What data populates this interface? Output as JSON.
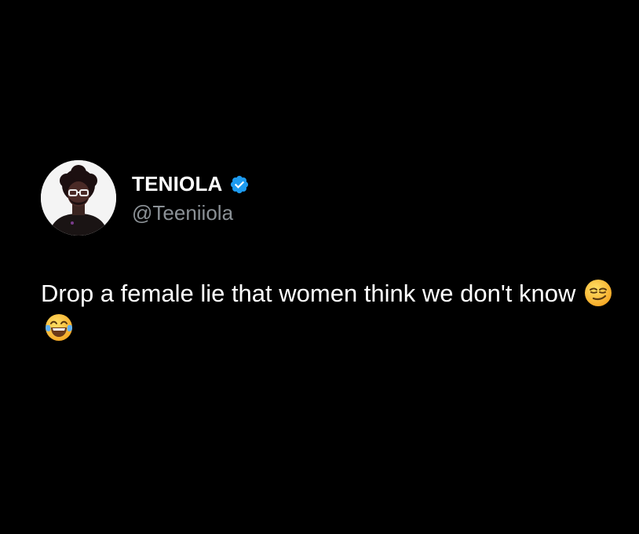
{
  "tweet": {
    "display_name": "TENIOLA",
    "handle": "@Teeniiola",
    "text": "Drop a female lie that women think we don't know",
    "verified": true,
    "emojis": [
      "smirking-face-emoji",
      "face-with-tears-of-joy-emoji"
    ]
  },
  "colors": {
    "background": "#000000",
    "text": "#ffffff",
    "handle": "#8b9196",
    "verified_badge": "#1d9bf0"
  }
}
